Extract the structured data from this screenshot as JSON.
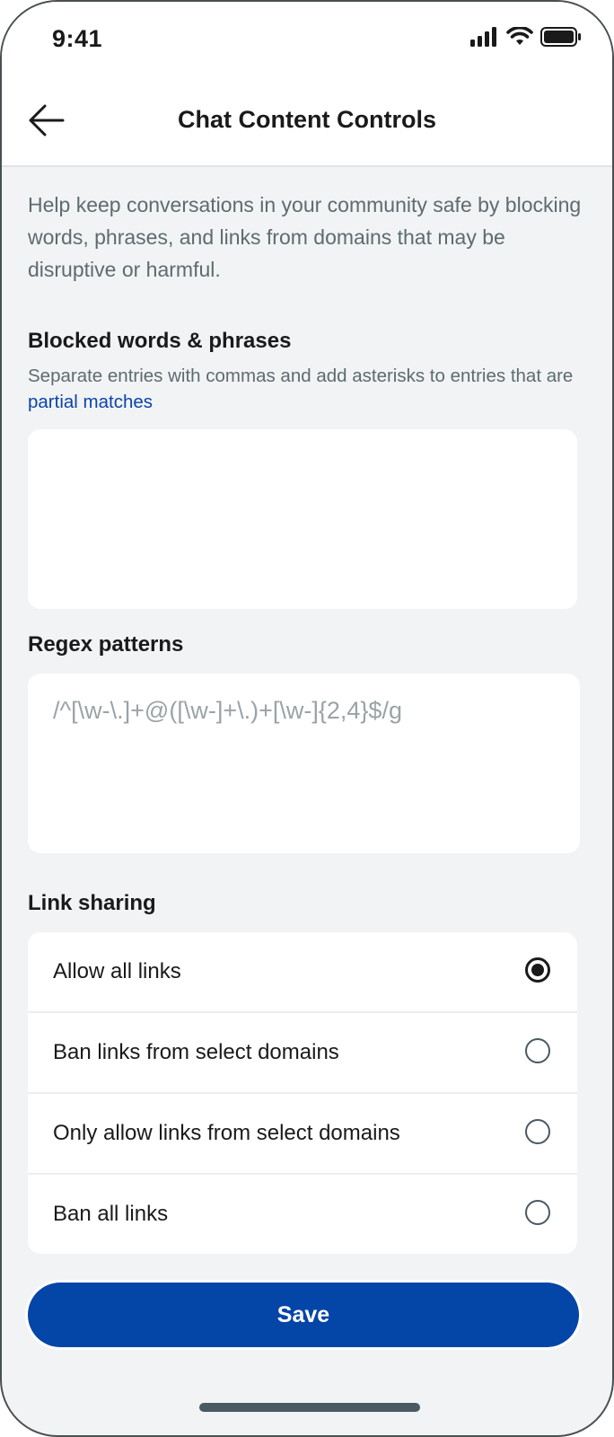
{
  "status_bar": {
    "time": "9:41"
  },
  "header": {
    "title": "Chat Content Controls"
  },
  "intro": "Help keep conversations in your community safe by blocking words, phrases, and links from domains that may be disruptive or harmful.",
  "blocked_words": {
    "label": "Blocked words & phrases",
    "helper_prefix": "Separate entries with commas and add asterisks to entries that are ",
    "helper_link": "partial matches",
    "value": ""
  },
  "regex": {
    "label": "Regex patterns",
    "placeholder": "/^[\\w-\\.]+@([\\w-]+\\.)+[\\w-]{2,4}$/g"
  },
  "link_sharing": {
    "label": "Link sharing",
    "options": [
      {
        "label": "Allow all links",
        "selected": true
      },
      {
        "label": "Ban links from select domains",
        "selected": false
      },
      {
        "label": "Only allow links from select domains",
        "selected": false
      },
      {
        "label": "Ban all links",
        "selected": false
      }
    ]
  },
  "save_label": "Save",
  "colors": {
    "accent": "#0445a8",
    "link": "#0a45a8",
    "background": "#f1f3f4"
  }
}
